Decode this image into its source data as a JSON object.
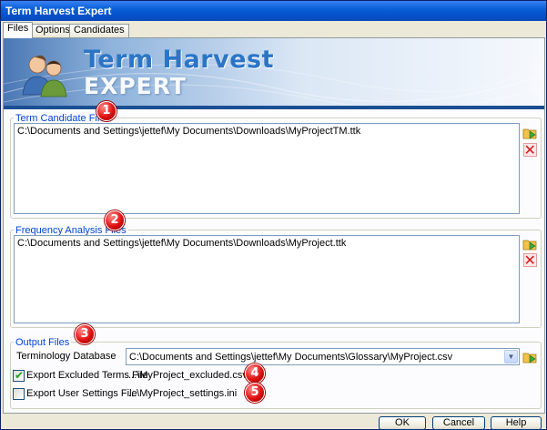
{
  "window": {
    "title": "Term Harvest Expert"
  },
  "tabs": [
    {
      "label": "Files",
      "active": true
    },
    {
      "label": "Options",
      "active": false
    },
    {
      "label": "Candidates",
      "active": false
    }
  ],
  "banner": {
    "line1": "Term Harvest",
    "line2": "EXPERT"
  },
  "term_candidate": {
    "label": "Term Candidate Files",
    "badge": "1",
    "items": [
      "C:\\Documents and Settings\\jettef\\My Documents\\Downloads\\MyProjectTM.ttk"
    ]
  },
  "frequency": {
    "label": "Frequency Analysis Files",
    "badge": "2",
    "items": [
      "C:\\Documents and Settings\\jettef\\My Documents\\Downloads\\MyProject.ttk"
    ]
  },
  "output": {
    "label": "Output Files",
    "badge": "3",
    "terminology_label": "Terminology Database",
    "terminology_value": "C:\\Documents and Settings\\jettef\\My Documents\\Glossary\\MyProject.csv",
    "export_excluded": {
      "label": "Export Excluded Terms File",
      "checked": true,
      "path": "...\\MyProject_excluded.csv",
      "badge": "4"
    },
    "export_settings": {
      "label": "Export User Settings File",
      "checked": false,
      "path": "...\\MyProject_settings.ini",
      "badge": "5"
    }
  },
  "buttons": {
    "ok": "OK",
    "cancel": "Cancel",
    "help": "Help"
  },
  "colors": {
    "accent": "#0046d5",
    "badge": "#e01010",
    "title_bar": "#0a5fd8"
  },
  "icons": {
    "add": "add-file-icon",
    "remove": "remove-icon",
    "dropdown": "chevron-down-icon",
    "logo": "people-icon"
  }
}
